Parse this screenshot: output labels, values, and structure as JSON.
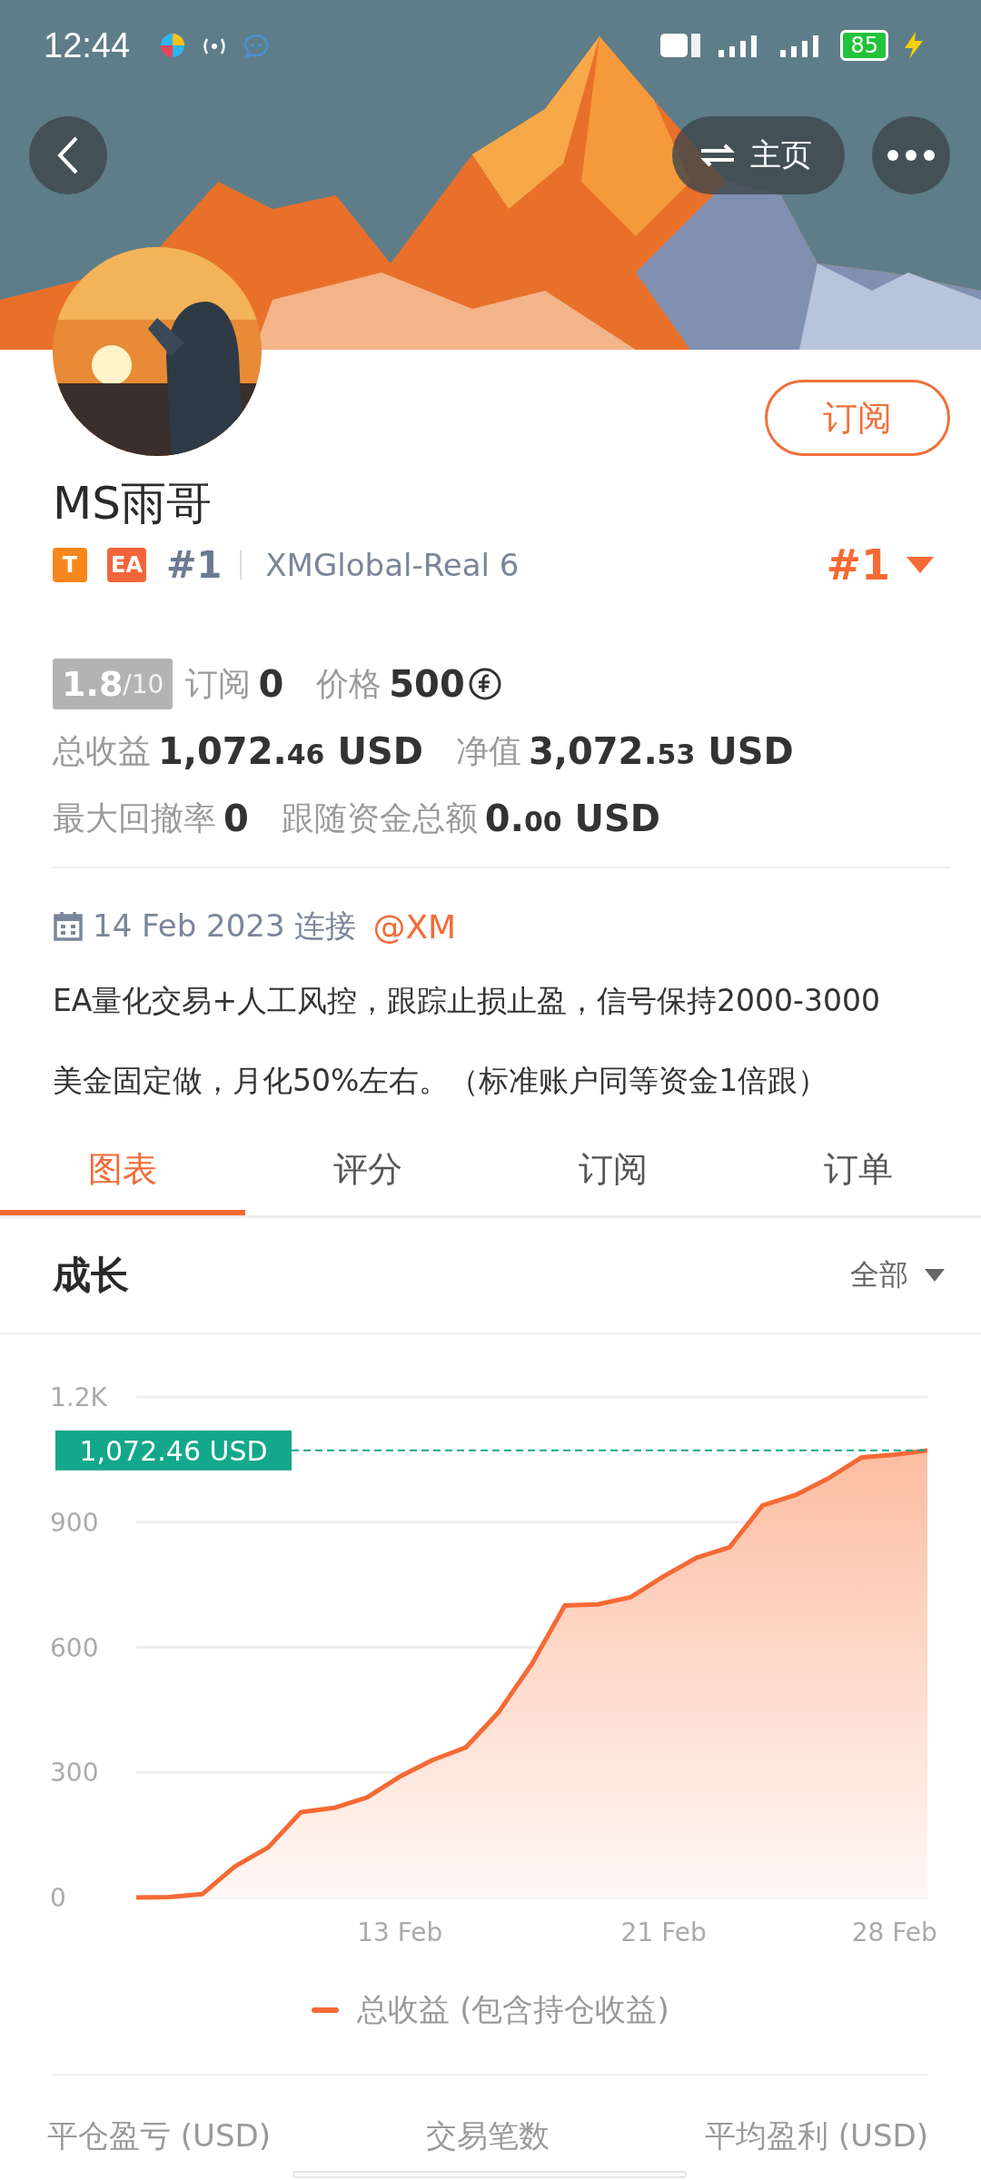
{
  "status_bar": {
    "time": "12:44",
    "battery": "85"
  },
  "nav": {
    "home_label": "主页"
  },
  "profile": {
    "subscribe_label": "订阅",
    "name": "MS雨哥",
    "badges": [
      {
        "text": "T",
        "color": "#f7861c"
      },
      {
        "text": "EA",
        "color": "#f2653a"
      }
    ],
    "rank": "#1",
    "server": "XMGlobal-Real 6",
    "rank_right": "#1"
  },
  "stats": {
    "score": "1.8",
    "score_max": "/10",
    "subscribers_label": "订阅",
    "subscribers": "0",
    "price_label": "价格",
    "price": "500",
    "rows": [
      [
        {
          "label": "总收益",
          "main": "1,072.",
          "decimals": "46",
          "unit": "USD"
        },
        {
          "label": "净值",
          "main": "3,072.",
          "decimals": "53",
          "unit": "USD"
        }
      ],
      [
        {
          "label": "最大回撤率",
          "main": "0"
        },
        {
          "label": "跟随资金总额",
          "main": "0.",
          "decimals": "00",
          "unit": "USD"
        }
      ]
    ]
  },
  "connection": {
    "date": "14 Feb 2023",
    "text": "连接",
    "broker": "@XM"
  },
  "description": "EA量化交易+人工风控，跟踪止损止盈，信号保持2000-3000美金固定做，月化50%左右。（标准账户同等资金1倍跟）",
  "tabs": [
    {
      "label": "图表",
      "selected": true
    },
    {
      "label": "评分",
      "selected": false
    },
    {
      "label": "订阅",
      "selected": false
    },
    {
      "label": "订单",
      "selected": false
    }
  ],
  "growth": {
    "title": "成长",
    "filter": "全部",
    "chart_data": {
      "type": "area",
      "categories": [
        null,
        null,
        null,
        null,
        null,
        null,
        null,
        null,
        "13 Feb",
        null,
        null,
        null,
        null,
        null,
        null,
        null,
        "21 Feb",
        null,
        null,
        null,
        null,
        null,
        null,
        "28 Feb",
        null
      ],
      "series": [
        {
          "name": "总收益 (包含持仓收益)",
          "color": "#f56a35",
          "values": [
            0,
            1,
            8,
            75,
            120,
            205,
            215,
            240,
            290,
            330,
            360,
            445,
            560,
            700,
            703,
            720,
            770,
            815,
            840,
            940,
            965,
            1005,
            1055,
            1062,
            1072
          ]
        }
      ],
      "ylim": [
        0,
        1200
      ],
      "yticks": [
        0,
        300,
        600,
        900,
        {
          "value": 1200,
          "label": "1.2K"
        }
      ],
      "grid": true,
      "ref_lines": [
        {
          "axis": "y",
          "value": 1072,
          "label": "1,072.46 USD",
          "color": "#14a88a"
        }
      ]
    }
  },
  "bottom_stats": [
    "平仓盈亏 (USD)",
    "交易笔数",
    "平均盈利 (USD)"
  ]
}
